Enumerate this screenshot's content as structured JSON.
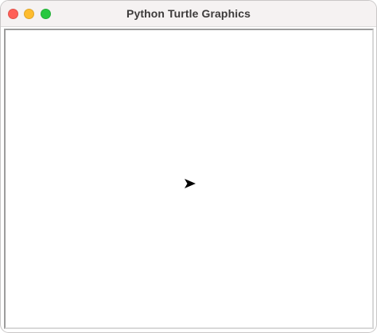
{
  "window": {
    "title": "Python Turtle Graphics"
  },
  "traffic_lights": {
    "close_color": "#ff5f57",
    "minimize_color": "#febc2e",
    "zoom_color": "#28c840"
  },
  "canvas": {
    "background_color": "#ffffff"
  },
  "turtle": {
    "shape": "classic-arrow",
    "heading": "east",
    "color": "#000000"
  }
}
